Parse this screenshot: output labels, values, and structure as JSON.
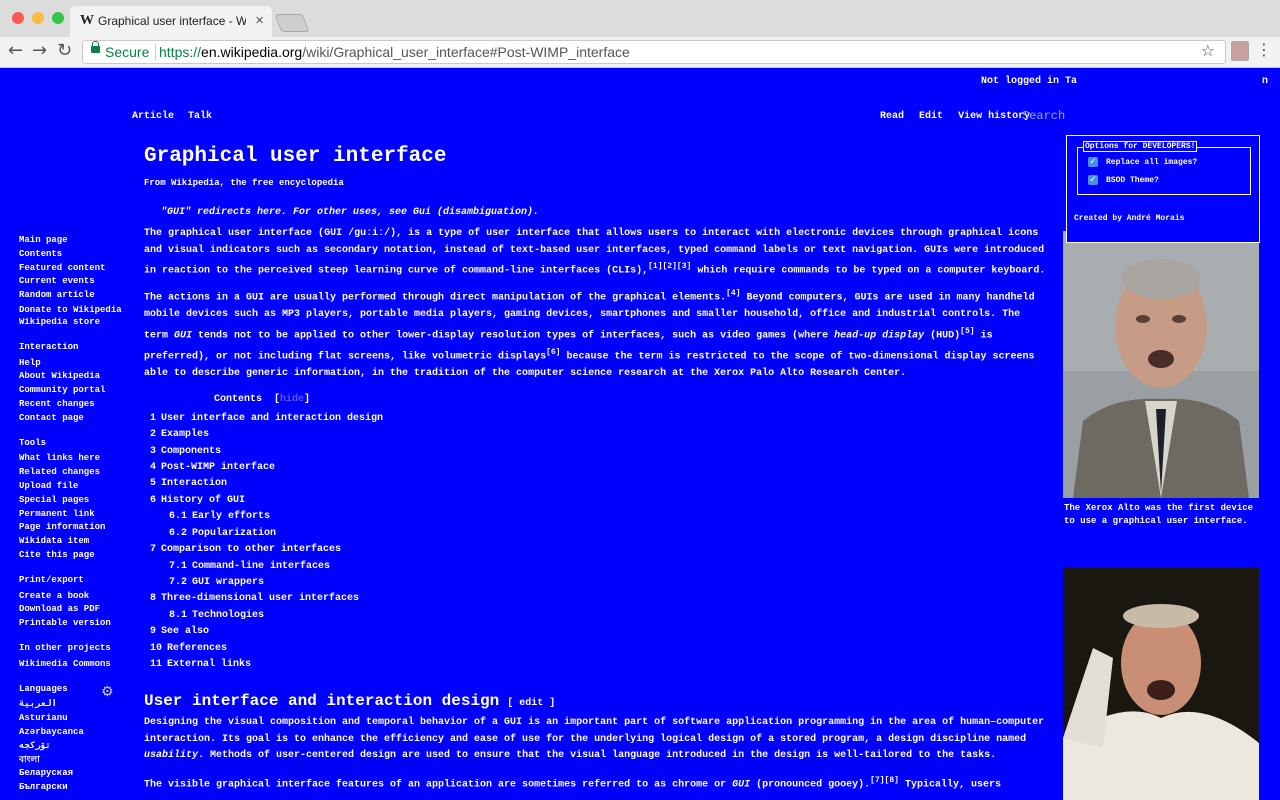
{
  "browser": {
    "tab_title": "Graphical user interface - Wiki",
    "tab_favicon": "W",
    "tab_close": "×",
    "secure_label": "Secure",
    "url_protocol": "https://",
    "url_host": "en.wikipedia.org",
    "url_path": "/wiki/Graphical_user_interface#Post-WIMP_interface",
    "icons": [
      "back-icon",
      "forward-icon",
      "reload-icon",
      "lock-icon",
      "star-icon",
      "extension-icon",
      "menu-icon"
    ]
  },
  "header": {
    "not_logged": "Not logged in  Ta",
    "login_fragment": "n",
    "tabs_left": [
      "Article",
      "Talk"
    ],
    "tabs_right": [
      "Read",
      "Edit",
      "View history"
    ],
    "search_placeholder": "Search"
  },
  "sidebar": {
    "nav": [
      "Main page",
      "Contents",
      "Featured content",
      "Current events",
      "Random article",
      "Donate to Wikipedia",
      "Wikipedia store"
    ],
    "interaction_head": "Interaction",
    "interaction": [
      "Help",
      "About Wikipedia",
      "Community portal",
      "Recent changes",
      "Contact page"
    ],
    "tools_head": "Tools",
    "tools": [
      "What links here",
      "Related changes",
      "Upload file",
      "Special pages",
      "Permanent link",
      "Page information",
      "Wikidata item",
      "Cite this page"
    ],
    "print_head": "Print/export",
    "print": [
      "Create a book",
      "Download as PDF",
      "Printable version"
    ],
    "projects_head": "In other projects",
    "projects": [
      "Wikimedia Commons"
    ],
    "languages_head": "Languages",
    "languages": [
      "العربية",
      "Asturianu",
      "Azərbaycanca",
      "تۆرکجه",
      "বাংলা",
      "Беларуская",
      "Български"
    ]
  },
  "article": {
    "title": "Graphical user interface",
    "tagline": "From Wikipedia, the free encyclopedia",
    "hatnote": "\"GUI\" redirects here. For other uses, see Gui (disambiguation).",
    "p1_a": "The ",
    "p1_b": "graphical user interface",
    "p1_c": " (",
    "p1_d": "GUI",
    "p1_e": " /ɡuːiː/), is a type of user interface that allows users to interact with electronic devices through graphical icons and visual indicators such as secondary notation, instead of text-based user interfaces, typed command labels or text navigation. GUIs were introduced in reaction to the perceived steep learning curve of command-line interfaces (CLIs),",
    "p1_sup": "[1][2][3]",
    "p1_f": " which require commands to be typed on a computer keyboard.",
    "p2_a": "The actions in a GUI are usually performed through direct manipulation of the graphical elements.",
    "p2_sup1": "[4]",
    "p2_b": " Beyond computers, GUIs are used in many handheld mobile devices such as MP3 players, portable media players, gaming devices, smartphones and smaller household, office and industrial controls. The term ",
    "p2_gui": "GUI",
    "p2_c": " tends not to be applied to other lower-display resolution types of interfaces, such as video games (where ",
    "p2_hud": "head-up display",
    "p2_d": " (HUD)",
    "p2_sup2": "[5]",
    "p2_e": " is preferred), or not including flat screens, like volumetric displays",
    "p2_sup3": "[6]",
    "p2_f": " because the term is restricted to the scope of two-dimensional display screens able to describe generic information, in the tradition of the computer science research at the Xerox Palo Alto Research Center.",
    "toc_title": "Contents",
    "toc_hide": "hide",
    "toc": [
      {
        "num": "1",
        "text": "User interface and interaction design",
        "sub": false
      },
      {
        "num": "2",
        "text": "Examples",
        "sub": false
      },
      {
        "num": "3",
        "text": "Components",
        "sub": false
      },
      {
        "num": "4",
        "text": "Post-WIMP interface",
        "sub": false
      },
      {
        "num": "5",
        "text": "Interaction",
        "sub": false
      },
      {
        "num": "6",
        "text": "History of GUI",
        "sub": false
      },
      {
        "num": "6.1",
        "text": "Early efforts",
        "sub": true
      },
      {
        "num": "6.2",
        "text": "Popularization",
        "sub": true
      },
      {
        "num": "7",
        "text": "Comparison to other interfaces",
        "sub": false
      },
      {
        "num": "7.1",
        "text": "Command-line interfaces",
        "sub": true
      },
      {
        "num": "7.2",
        "text": "GUI wrappers",
        "sub": true
      },
      {
        "num": "8",
        "text": "Three-dimensional user interfaces",
        "sub": false
      },
      {
        "num": "8.1",
        "text": "Technologies",
        "sub": true
      },
      {
        "num": "9",
        "text": "See also",
        "sub": false
      },
      {
        "num": "10",
        "text": "References",
        "sub": false
      },
      {
        "num": "11",
        "text": "External links",
        "sub": false
      }
    ],
    "h2": "User interface and interaction design",
    "h2_edit": "edit",
    "p3_a": "Designing the visual composition and temporal behavior of a GUI is an important part of software application programming in the area of human–computer interaction. Its goal is to enhance the efficiency and ease of use for the underlying logical design of a stored program, a design discipline named ",
    "p3_b": "usability",
    "p3_c": ". Methods of user-centered design are used to ensure that the visual language introduced in the design is well-tailored to the tasks.",
    "p4_a": "The visible graphical interface features of an application are sometimes referred to as chrome or ",
    "p4_b": "GUI",
    "p4_c": " (pronounced gooey).",
    "p4_sup": "[7][8]",
    "p4_d": " Typically, users",
    "caption1": "The Xerox Alto was the first device to use a graphical user interface."
  },
  "popup": {
    "legend": "Options for DEVELOPERS!",
    "opt1": "Replace all images?",
    "opt2": "BSOD Theme?",
    "check": "✓",
    "credit": "Created by André Morais"
  }
}
